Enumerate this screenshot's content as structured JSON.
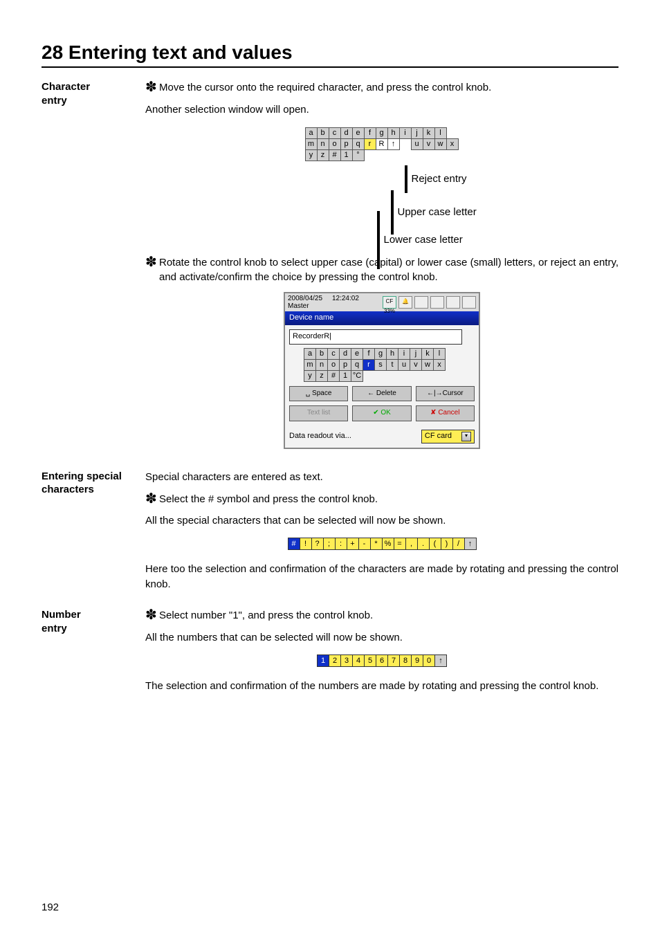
{
  "page_number": "192",
  "heading": "28 Entering text and values",
  "sections": {
    "char_entry": {
      "label": "Character entry",
      "star1": "Move the cursor onto the required character, and press the control knob.",
      "line1": "Another selection window will open.",
      "star2": "Rotate the control knob to select upper case (capital) or lower case (small) letters, or reject an entry, and activate/confirm the choice by pressing the control knob."
    },
    "special": {
      "label": "Entering special characters",
      "line1": "Special characters are entered as text.",
      "star1": "Select the # symbol and press the control knob.",
      "line2": "All the special characters that can be selected will now be shown.",
      "line3": "Here too the selection and confirmation of the characters are made by rotating and pressing the control knob."
    },
    "number": {
      "label": "Number entry",
      "star1": "Select number \"1\", and press the control knob.",
      "line1": "All the numbers that can be selected will now be shown.",
      "line2": "The selection and confirmation of the numbers are made by rotating and pressing the control knob."
    }
  },
  "fig1": {
    "row1": [
      "a",
      "b",
      "c",
      "d",
      "e",
      "f",
      "g",
      "h",
      "i",
      "j",
      "k",
      "l"
    ],
    "row2": [
      "m",
      "n",
      "o",
      "p",
      "q",
      "r",
      "R",
      "↑",
      "",
      "u",
      "v",
      "w",
      "x"
    ],
    "row3": [
      "y",
      "z",
      "#",
      "1",
      "°"
    ],
    "callouts": {
      "reject": "Reject entry",
      "upper": "Upper case letter",
      "lower": "Lower case letter"
    }
  },
  "device": {
    "date": "2008/04/25",
    "time": "12:24:02",
    "source": "Master",
    "cf_pct": "33%",
    "title": "Device name",
    "input_value": "RecorderR|",
    "rows": [
      [
        "a",
        "b",
        "c",
        "d",
        "e",
        "f",
        "g",
        "h",
        "i",
        "j",
        "k",
        "l"
      ],
      [
        "m",
        "n",
        "o",
        "p",
        "q",
        "r",
        "s",
        "t",
        "u",
        "v",
        "w",
        "x"
      ],
      [
        "y",
        "z",
        "#",
        "1",
        "°C"
      ]
    ],
    "sel_char": "r",
    "buttons": {
      "space": "␣ Space",
      "delete": "← Delete",
      "cursor": "←|→Cursor",
      "textlist": "Text list",
      "ok": "✔ OK",
      "cancel": "✘ Cancel"
    },
    "footer_label": "Data readout via...",
    "footer_value": "CF card"
  },
  "special_strip": [
    "#",
    "!",
    "?",
    ";",
    ":",
    "+",
    "-",
    "*",
    "%",
    "=",
    ",",
    ".",
    "(",
    ")",
    "/",
    "↑"
  ],
  "number_strip": [
    "1",
    "2",
    "3",
    "4",
    "5",
    "6",
    "7",
    "8",
    "9",
    "0",
    "↑"
  ]
}
